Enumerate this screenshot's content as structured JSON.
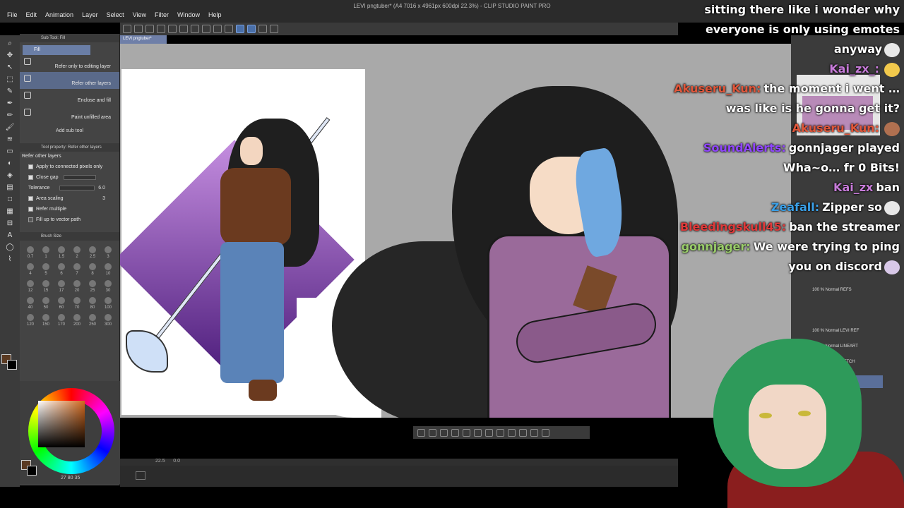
{
  "window": {
    "title": "LEVI pngtuber* (A4 7016 x 4961px 600dpi 22.3%) - CLIP STUDIO PAINT PRO",
    "menu": [
      "File",
      "Edit",
      "Animation",
      "Layer",
      "Select",
      "View",
      "Filter",
      "Window",
      "Help"
    ]
  },
  "canvas": {
    "tab_label": "LEVI pngtuber*"
  },
  "subtool": {
    "header": "Sub Tool: Fill",
    "active_group": "Fill",
    "items": [
      "Refer only to editing layer",
      "Refer other layers",
      "Enclose and fill",
      "Paint unfilled area"
    ],
    "add_label": "Add sub tool"
  },
  "tool_property": {
    "header": "Tool property: Refer other layers",
    "title": "Refer other layers",
    "rows": [
      {
        "label": "Apply to connected pixels only",
        "value": ""
      },
      {
        "label": "Close gap",
        "value": ""
      },
      {
        "label": "Tolerance",
        "value": "6.0"
      },
      {
        "label": "Area scaling",
        "value": "3"
      },
      {
        "label": "Refer multiple",
        "value": ""
      },
      {
        "label": "Fill up to vector path",
        "value": ""
      }
    ]
  },
  "brush_size": {
    "header": "Brush Size",
    "sizes": [
      "0.7",
      "1",
      "1.5",
      "2",
      "2.5",
      "3",
      "4",
      "5",
      "6",
      "7",
      "8",
      "10",
      "12",
      "15",
      "17",
      "20",
      "25",
      "30",
      "40",
      "50",
      "60",
      "70",
      "80",
      "100",
      "120",
      "150",
      "170",
      "200",
      "250",
      "300"
    ]
  },
  "color": {
    "main": "#5a3a22",
    "sub": "#000000",
    "values": "27  80  35"
  },
  "status": {
    "zoom": "22.5",
    "angle": "0.0"
  },
  "layers": {
    "items": [
      {
        "label": "100 % Normal REFS"
      },
      {
        "label": "100 % Normal LEVI REF"
      },
      {
        "label": "100 % Normal LINEART"
      },
      {
        "label": "50 % Normal SKETCH"
      },
      {
        "label": "100 % Normal"
      },
      {
        "label": "100 % Normal"
      }
    ]
  },
  "chat": [
    {
      "user": "",
      "user_color": "#ffffff",
      "text": "sitting there like i wonder why everyone is only using emotes anyway",
      "emote": "#e8e8e8"
    },
    {
      "user": "Kai_zx_:",
      "user_color": "#c77bd9",
      "text": "",
      "emote": "#f2c94c"
    },
    {
      "user": "Akuseru_Kun:",
      "user_color": "#e0563a",
      "text": "the moment i went … was like is he gonna get it?",
      "emote": ""
    },
    {
      "user": "Akuseru_Kun:",
      "user_color": "#e0563a",
      "text": "",
      "emote": "#b07050"
    },
    {
      "user": "SoundAlerts:",
      "user_color": "#9146ff",
      "text": "gonnjager played Wha~o… fr 0 Bits!",
      "emote": ""
    },
    {
      "user": "Kai_zx",
      "user_color": "#c77bd9",
      "text": "ban",
      "emote": ""
    },
    {
      "user": "Zeafall:",
      "user_color": "#3aa0e8",
      "text": "Zipper so",
      "emote": "#e8e8e8"
    },
    {
      "user": "Bleedingskull45:",
      "user_color": "#e03a3a",
      "text": "ban the streamer",
      "emote": ""
    },
    {
      "user": "gonnjager:",
      "user_color": "#9acd6a",
      "text": "We were trying to ping you on discord",
      "emote": "#d8c8e8"
    }
  ]
}
